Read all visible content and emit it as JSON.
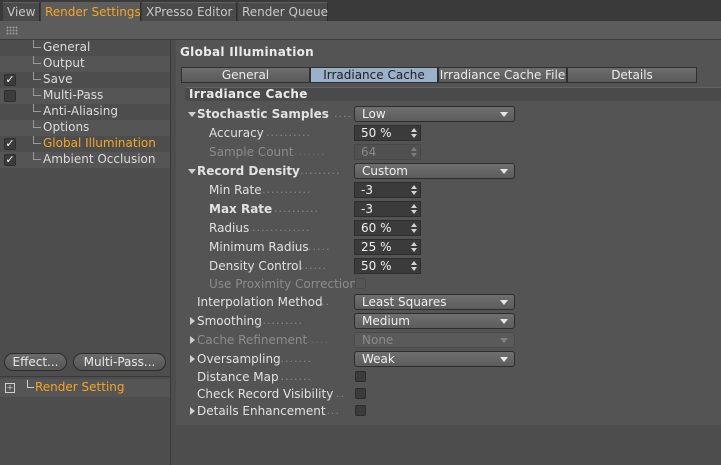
{
  "tabs": [
    {
      "label": "View",
      "active": false
    },
    {
      "label": "Render Settings",
      "active": true
    },
    {
      "label": "XPresso Editor",
      "active": false
    },
    {
      "label": "Render Queue",
      "active": false
    }
  ],
  "sidebar": {
    "items": [
      {
        "label": "General",
        "checked": null,
        "selected": false
      },
      {
        "label": "Output",
        "checked": null,
        "selected": false
      },
      {
        "label": "Save",
        "checked": true,
        "selected": false
      },
      {
        "label": "Multi-Pass",
        "checked": false,
        "selected": false
      },
      {
        "label": "Anti-Aliasing",
        "checked": null,
        "selected": false
      },
      {
        "label": "Options",
        "checked": null,
        "selected": false
      },
      {
        "label": "Global Illumination",
        "checked": true,
        "selected": true
      },
      {
        "label": "Ambient Occlusion",
        "checked": true,
        "selected": false
      }
    ],
    "effect_button": "Effect...",
    "multipass_button": "Multi-Pass...",
    "render_setting_label": "Render Setting"
  },
  "panel": {
    "title": "Global Illumination",
    "subtabs": [
      {
        "label": "General",
        "active": false
      },
      {
        "label": "Irradiance Cache",
        "active": true
      },
      {
        "label": "Irradiance Cache File",
        "active": false
      },
      {
        "label": "Details",
        "active": false
      }
    ],
    "section_title": "Irradiance Cache",
    "params": {
      "stochastic_samples": {
        "label": "Stochastic Samples",
        "value": "Low"
      },
      "accuracy": {
        "label": "Accuracy",
        "value": "50 %"
      },
      "sample_count": {
        "label": "Sample Count",
        "value": "64"
      },
      "record_density": {
        "label": "Record Density",
        "value": "Custom"
      },
      "min_rate": {
        "label": "Min Rate",
        "value": "-3"
      },
      "max_rate": {
        "label": "Max Rate",
        "value": "-3"
      },
      "radius": {
        "label": "Radius",
        "value": "60 %"
      },
      "minimum_radius": {
        "label": "Minimum Radius",
        "value": "25 %"
      },
      "density_control": {
        "label": "Density Control",
        "value": "50 %"
      },
      "use_proximity_correction": {
        "label": "Use Proximity Correction",
        "checked": false
      },
      "interpolation_method": {
        "label": "Interpolation Method",
        "value": "Least Squares"
      },
      "smoothing": {
        "label": "Smoothing",
        "value": "Medium"
      },
      "cache_refinement": {
        "label": "Cache Refinement",
        "value": "None"
      },
      "oversampling": {
        "label": "Oversampling",
        "value": "Weak"
      },
      "distance_map": {
        "label": "Distance Map",
        "checked": false
      },
      "check_record_visibility": {
        "label": "Check Record Visibility",
        "checked": false
      },
      "details_enhancement": {
        "label": "Details Enhancement",
        "checked": false
      }
    }
  }
}
